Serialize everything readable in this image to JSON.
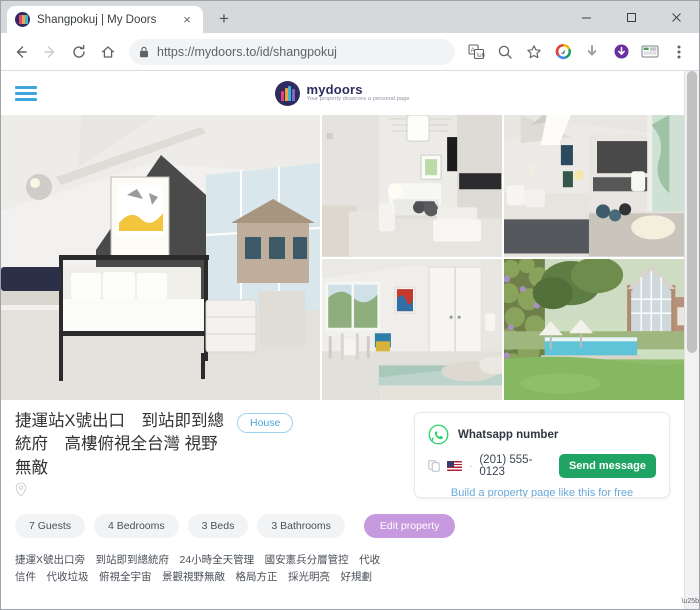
{
  "browser": {
    "tab": {
      "title": "Shangpokuj | My Doors",
      "favicon": "mydoors-logo-icon",
      "close": "×"
    },
    "new_tab": "+",
    "window_controls": {
      "minimize": "—",
      "maximize": "☐",
      "close": "✕"
    },
    "nav": {
      "back": "←",
      "forward": "→",
      "reload": "⟳",
      "home": "⌂"
    },
    "omnibox": {
      "lock": "🔒",
      "scheme": "https://",
      "host": "mydoors.to",
      "path": "/id/shangpokuj",
      "full_url": "https://mydoors.to/id/shangpokuj"
    },
    "toolbar_icons": [
      {
        "name": "translate-icon",
        "glyph": "字"
      },
      {
        "name": "zoom-search-icon",
        "glyph": "⌕"
      },
      {
        "name": "bookmark-star-icon",
        "glyph": "☆"
      },
      {
        "name": "extension-compass-icon",
        "glyph": "◔"
      },
      {
        "name": "download-arrow-icon",
        "glyph": "⬇"
      },
      {
        "name": "download-manager-icon",
        "glyph": "⬇"
      },
      {
        "name": "reading-list-icon",
        "glyph": "▤"
      },
      {
        "name": "chrome-menu-icon",
        "glyph": "⋮"
      }
    ]
  },
  "site": {
    "menu_icon": "hamburger-icon",
    "brand": {
      "name": "mydoors",
      "tagline": "Your property deserves a personal page"
    }
  },
  "gallery": {
    "photos": [
      {
        "alt": "attic bedroom with black metal bed and yellow art print",
        "position": "main"
      },
      {
        "alt": "living room with fireplace and wall tv",
        "position": "top-left"
      },
      {
        "alt": "lounge with fireplace, tv and glass doors to garden",
        "position": "top-right"
      },
      {
        "alt": "bedroom with desk and garden window",
        "position": "bottom-left"
      },
      {
        "alt": "garden exterior with pool and gabled house",
        "position": "bottom-right"
      }
    ]
  },
  "property": {
    "title": "捷運站X號出口　到站即到總統府　高樓俯視全台灣 視野無敵",
    "type_badge": "House",
    "location_icon": "location-pin-icon",
    "location_text": "",
    "facts": [
      "7 Guests",
      "4 Bedrooms",
      "3 Beds",
      "3 Bathrooms"
    ],
    "edit_label": "Edit property",
    "description": "捷運X號出口旁　到站即到總統府　24小時全天管理　國安憲兵分層管控　代收信件　代收垃圾　俯視全宇宙　景觀視野無敵　格局方正　採光明亮　好規劃"
  },
  "whatsapp_card": {
    "icon": "whatsapp-icon",
    "label": "Whatsapp number",
    "copy_icon": "copy-icon",
    "flag": "us-flag-icon",
    "separator": "·",
    "phone": "(201) 555-0123",
    "send_label": "Send message",
    "promo": "Build a property page like this for free"
  },
  "colors": {
    "accent_blue": "#41a5dd",
    "badge_blue": "#4ea6dd",
    "whatsapp_green": "#1fa463",
    "edit_purple": "#c79ae0",
    "brand_navy": "#2e2c5e",
    "text_dark": "#333333",
    "chip_bg": "#f2f3f5"
  }
}
